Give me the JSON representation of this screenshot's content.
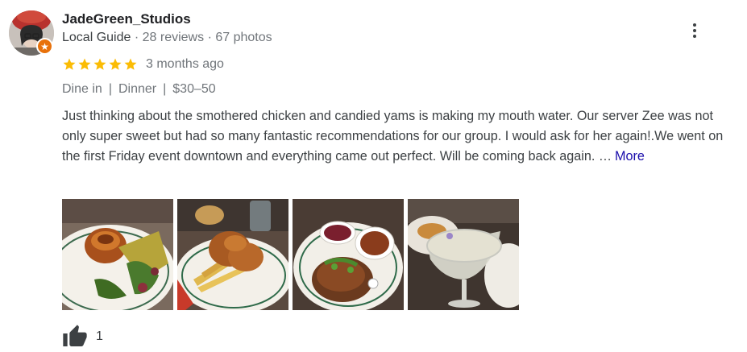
{
  "reviewer": {
    "name": "JadeGreen_Studios",
    "level": "Local Guide",
    "separator": "·",
    "reviews": "28 reviews",
    "photos": "67 photos"
  },
  "rating": {
    "stars": 5,
    "max": 5,
    "time": "3 months ago"
  },
  "tags": [
    "Dine in",
    "Dinner",
    "$30–50"
  ],
  "tag_separator": "|",
  "review_text": "Just thinking about the smothered chicken and candied yams is making my mouth water. Our server Zee was not only super sweet but had so many fantastic recommendations for our group. I would ask for her again!.We went on the first Friday event downtown and everything came out perfect. Will be coming back again. …",
  "more_label": "More",
  "likes": "1",
  "colors": {
    "star": "#fbbc04",
    "badge": "#e8710a",
    "link": "#1a0dab"
  },
  "icons": {
    "menu": "more-vert-icon",
    "like": "thumb-up-icon",
    "badge": "star-badge-icon"
  },
  "review_photos": [
    "candied-yams-plate",
    "fried-chicken-and-fries-plate",
    "smothered-chicken-plate",
    "cocktail-glass"
  ]
}
